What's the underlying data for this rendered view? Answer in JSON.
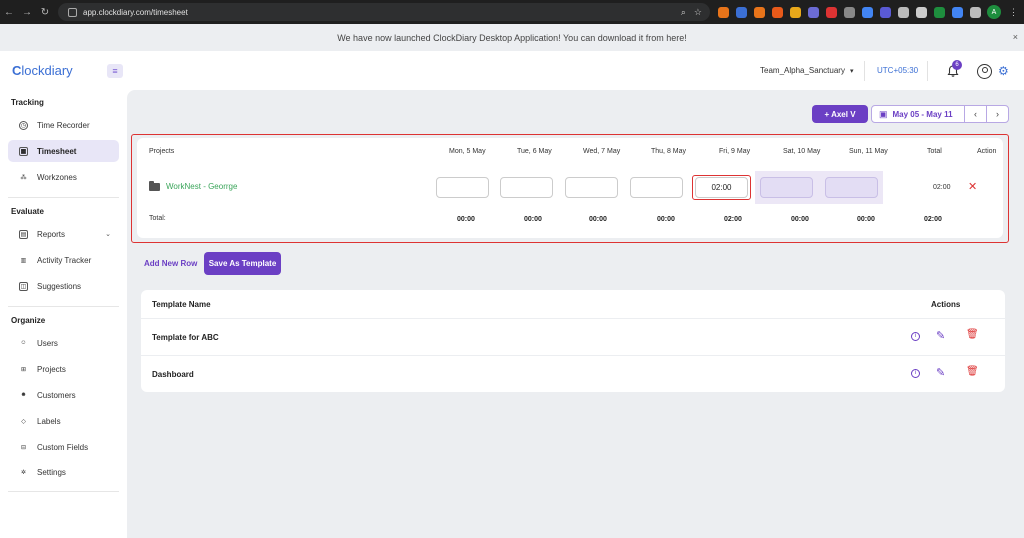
{
  "browser": {
    "url": "app.clockdiary.com/timesheet",
    "account_initial": "A",
    "extension_colors": [
      "#e8741a",
      "#3b6fd4",
      "#e8741a",
      "#e85a1a",
      "#e8a81a",
      "#6b6bd4",
      "#d33",
      "#888",
      "#4285f4",
      "#5a5ad4",
      "#bbb",
      "#ccc",
      "#1e8e3e",
      "#4285f4",
      "#bbb"
    ]
  },
  "banner": {
    "text": "We have now launched ClockDiary Desktop Application! You can download it from here!",
    "close": "×"
  },
  "header": {
    "logo_c": "C",
    "logo_rest": "lockdiary",
    "hamburger": "≡",
    "team": "Team_Alpha_Sanctuary",
    "timezone": "UTC+05:30",
    "notification_count": "6"
  },
  "sidebar": {
    "sections": [
      "Tracking",
      "Evaluate",
      "Organize"
    ],
    "items": [
      {
        "label": "Time Recorder",
        "icon": "◷"
      },
      {
        "label": "Timesheet",
        "icon": "▦"
      },
      {
        "label": "Workzones",
        "icon": "⁂"
      },
      {
        "label": "Reports",
        "icon": "▤"
      },
      {
        "label": "Activity Tracker",
        "icon": "▥"
      },
      {
        "label": "Suggestions",
        "icon": "◫"
      },
      {
        "label": "Users",
        "icon": "☺"
      },
      {
        "label": "Projects",
        "icon": "⊞"
      },
      {
        "label": "Customers",
        "icon": "☻"
      },
      {
        "label": "Labels",
        "icon": "◇"
      },
      {
        "label": "Custom Fields",
        "icon": "⊟"
      },
      {
        "label": "Settings",
        "icon": "✲"
      }
    ]
  },
  "toolbar": {
    "user_button": "+ Axel V",
    "date_range": "May 05 - May 11",
    "prev": "‹",
    "next": "›"
  },
  "timesheet": {
    "headers": [
      "Projects",
      "Mon, 5 May",
      "Tue, 6 May",
      "Wed, 7 May",
      "Thu, 8 May",
      "Fri, 9 May",
      "Sat, 10 May",
      "Sun, 11 May",
      "Total",
      "Action"
    ],
    "project": "WorkNest - Georrge",
    "entries": [
      "",
      "",
      "",
      "",
      "02:00",
      "",
      ""
    ],
    "row_total": "02:00",
    "delete": "✕",
    "total_label": "Total:",
    "totals": [
      "00:00",
      "00:00",
      "00:00",
      "00:00",
      "02:00",
      "00:00",
      "00:00",
      "02:00"
    ]
  },
  "actions": {
    "add_row": "Add New Row",
    "save_template": "Save As Template"
  },
  "templates": {
    "headers": [
      "Template Name",
      "Actions"
    ],
    "rows": [
      "Template for ABC",
      "Dashboard"
    ]
  }
}
